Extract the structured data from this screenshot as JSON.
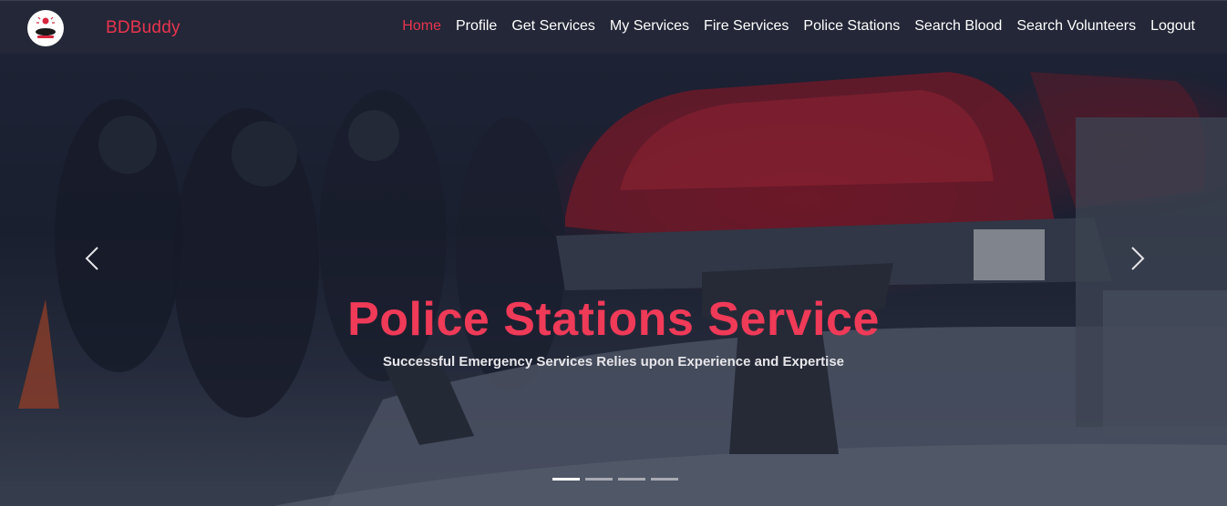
{
  "brand": {
    "name": "BDBuddy"
  },
  "nav": {
    "items": [
      {
        "label": "Home",
        "active": true
      },
      {
        "label": "Profile",
        "active": false
      },
      {
        "label": "Get Services",
        "active": false
      },
      {
        "label": "My Services",
        "active": false
      },
      {
        "label": "Fire Services",
        "active": false
      },
      {
        "label": "Police Stations",
        "active": false
      },
      {
        "label": "Search Blood",
        "active": false
      },
      {
        "label": "Search Volunteers",
        "active": false
      },
      {
        "label": "Logout",
        "active": false
      }
    ]
  },
  "carousel": {
    "slide_title": "Police Stations Service",
    "slide_subtitle": "Successful Emergency Services Relies upon Experience and Expertise",
    "prev_icon": "chevron-left-icon",
    "next_icon": "chevron-right-icon",
    "slide_count": 4,
    "active_slide": 1
  },
  "colors": {
    "navbar_bg": "#232737",
    "accent": "#e8344f",
    "title": "#ef3a58",
    "text": "#ffffff"
  }
}
